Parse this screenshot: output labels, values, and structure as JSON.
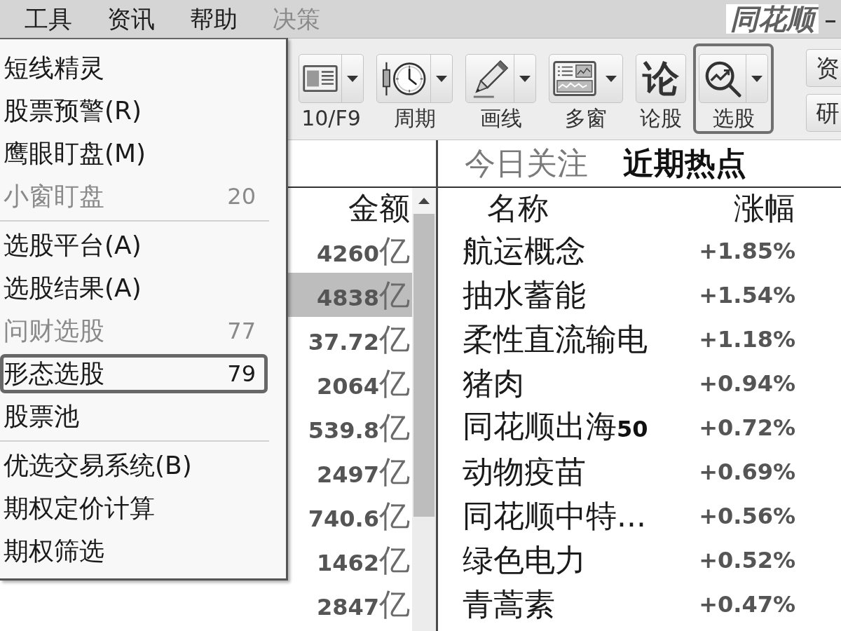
{
  "menu_bar": {
    "items": [
      {
        "label": "工具",
        "disabled": false
      },
      {
        "label": "资讯",
        "disabled": false
      },
      {
        "label": "帮助",
        "disabled": false
      },
      {
        "label": "决策",
        "disabled": true
      }
    ],
    "logo": "同花顺"
  },
  "toolbar": {
    "buttons": [
      {
        "kind": "document",
        "label": "10/F9",
        "dropdown": true,
        "highlighted": false
      },
      {
        "kind": "clock",
        "label": "周期",
        "dropdown": true,
        "highlighted": false
      },
      {
        "kind": "pencil",
        "label": "画线",
        "dropdown": true,
        "highlighted": false
      },
      {
        "kind": "layout",
        "label": "多窗",
        "dropdown": true,
        "highlighted": false
      },
      {
        "kind": "glyph",
        "glyph": "论",
        "label": "论股",
        "dropdown": false,
        "highlighted": false
      },
      {
        "kind": "magnifier",
        "label": "选股",
        "dropdown": true,
        "highlighted": true
      }
    ],
    "side_buttons": [
      {
        "label": "资"
      },
      {
        "label": "研"
      }
    ]
  },
  "dropdown_menu": {
    "items": [
      {
        "kind": "item",
        "label": "短线精灵",
        "disabled": false,
        "highlighted": false
      },
      {
        "kind": "item",
        "label": "股票预警(R)",
        "disabled": false,
        "highlighted": false
      },
      {
        "kind": "item",
        "label": "鹰眼盯盘(M)",
        "disabled": false,
        "highlighted": false
      },
      {
        "kind": "item",
        "label": "小窗盯盘",
        "shortcut": "20",
        "disabled": true,
        "highlighted": false
      },
      {
        "kind": "separator"
      },
      {
        "kind": "item",
        "label": "选股平台(A)",
        "disabled": false,
        "highlighted": false
      },
      {
        "kind": "item",
        "label": "选股结果(A)",
        "disabled": false,
        "highlighted": false
      },
      {
        "kind": "item",
        "label": "问财选股",
        "shortcut": "77",
        "disabled": true,
        "highlighted": false
      },
      {
        "kind": "item",
        "label": "形态选股",
        "shortcut": "79",
        "disabled": false,
        "highlighted": true
      },
      {
        "kind": "item",
        "label": "股票池",
        "disabled": false,
        "highlighted": false
      },
      {
        "kind": "separator"
      },
      {
        "kind": "item",
        "label": "优选交易系统(B)",
        "disabled": false,
        "highlighted": false
      },
      {
        "kind": "item",
        "label": "期权定价计算",
        "disabled": false,
        "highlighted": false
      },
      {
        "kind": "item",
        "label": "期权筛选",
        "disabled": false,
        "highlighted": false
      }
    ]
  },
  "amount_table": {
    "header": "金额",
    "rows": [
      {
        "value": "**4260**亿",
        "selected": false
      },
      {
        "value": "**4838**亿",
        "selected": true
      },
      {
        "value": "**37.72**亿",
        "selected": false
      },
      {
        "value": "**2064**亿",
        "selected": false
      },
      {
        "value": "**539.8**亿",
        "selected": false
      },
      {
        "value": "**2497**亿",
        "selected": false
      },
      {
        "value": "**740.6**亿",
        "selected": false
      },
      {
        "value": "**1462**亿",
        "selected": false
      },
      {
        "value": "**2847**亿",
        "selected": false
      }
    ]
  },
  "hot_panel": {
    "tabs": [
      {
        "label": "今日关注",
        "selected": false
      },
      {
        "label": "近期热点",
        "selected": true
      }
    ],
    "columns": [
      "名称",
      "涨幅"
    ],
    "rows": [
      {
        "name": "航运概念",
        "change": "+1.85%"
      },
      {
        "name": "抽水蓄能",
        "change": "+1.54%"
      },
      {
        "name": "柔性直流输电",
        "change": "+1.18%"
      },
      {
        "name": "猪肉",
        "change": "+0.94%"
      },
      {
        "name": "同花顺出海**50**",
        "change": "+0.72%"
      },
      {
        "name": "动物疫苗",
        "change": "+0.69%"
      },
      {
        "name": "同花顺中特...",
        "change": "+0.56%"
      },
      {
        "name": "绿色电力",
        "change": "+0.52%"
      },
      {
        "name": "青蒿素",
        "change": "+0.47%"
      }
    ]
  }
}
